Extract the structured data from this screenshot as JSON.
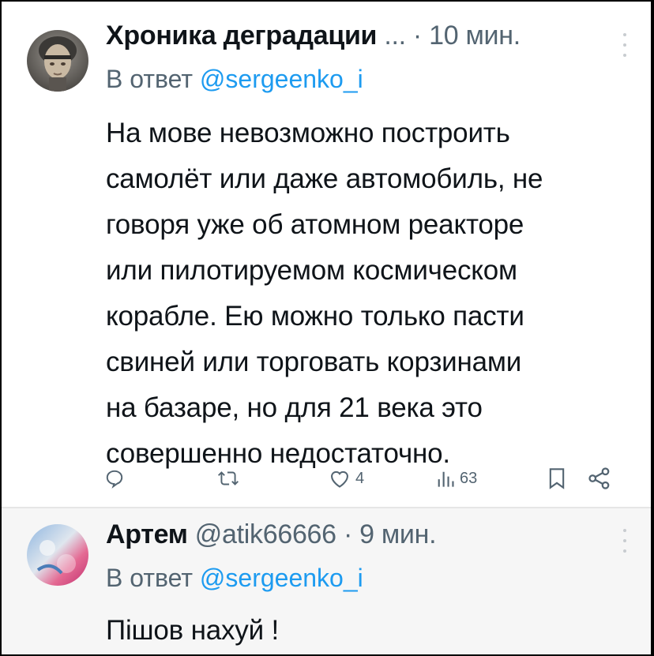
{
  "tweets": [
    {
      "display_name": "Хроника деградации",
      "ellipsis": "...",
      "time": "· 10 мин.",
      "reply_prefix": "В ответ",
      "reply_mention": "@sergeenko_i",
      "text": "На мове невозможно построить\nсамолёт или даже автомобиль, не\nговоря уже об атомном реакторе\nили пилотируемом космическом\nкорабле. Ею можно только пасти\nсвиней или торговать корзинами\nна базаре, но для 21 века это\nсовершенно недостаточно.",
      "actions": {
        "reply_count": "",
        "retweet_count": "",
        "like_count": "4",
        "views_count": "63"
      }
    },
    {
      "display_name": "Артем",
      "handle": "@atik66666",
      "time": "· 9 мин.",
      "reply_prefix": "В ответ",
      "reply_mention": "@sergeenko_i",
      "text": "Пішов нахуй !"
    }
  ],
  "icons": {
    "reply": "reply-icon",
    "retweet": "retweet-icon",
    "like": "heart-icon",
    "views": "views-chart-icon",
    "bookmark": "bookmark-icon",
    "share": "share-icon",
    "more": "more-icon"
  },
  "colors": {
    "text": "#0f1419",
    "secondary": "#536471",
    "link": "#1d9bf0",
    "background": "#ffffff"
  }
}
